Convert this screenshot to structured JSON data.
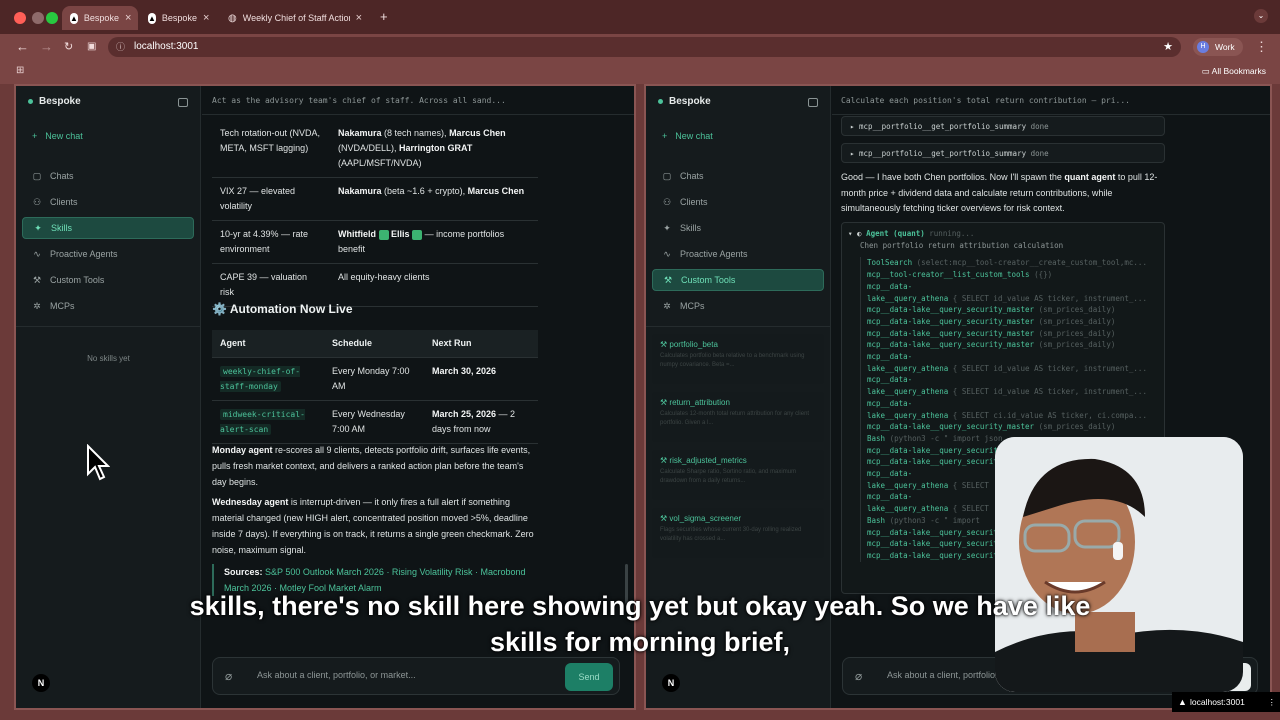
{
  "browser": {
    "tabs": [
      {
        "label": "Bespoke",
        "active": true
      },
      {
        "label": "Bespoke",
        "active": false
      },
      {
        "label": "Weekly Chief of Staff Action",
        "active": false
      }
    ],
    "url": "localhost:3001",
    "profile": "Work",
    "profile_initial": "H",
    "bookmarks_label": "All Bookmarks"
  },
  "left": {
    "app_name": "Bespoke",
    "new_chat": "New chat",
    "nav": [
      "Chats",
      "Clients",
      "Skills",
      "Proactive Agents",
      "Custom Tools",
      "MCPs"
    ],
    "active_nav": "Skills",
    "empty_state": "No skills yet",
    "prompt": "Act as the advisory team's chief of staff. Across all sand...",
    "risk_rows": [
      {
        "c1": "Tech rotation-out (NVDA, META, MSFT lagging)",
        "c2a": "Nakamura",
        "c2b": " (8 tech names), ",
        "c2c": "Marcus Chen",
        "c2d": " (NVDA/DELL), ",
        "c2e": "Harrington GRAT",
        "c2f": " (AAPL/MSFT/NVDA)"
      },
      {
        "c1": "VIX 27 — elevated volatility",
        "c2a": "Nakamura",
        "c2b": " (beta ~1.6 + crypto), ",
        "c2c": "Marcus Chen",
        "c2d": "",
        "c2e": "",
        "c2f": ""
      },
      {
        "c1": "10-yr at 4.39% — rate environment",
        "c2a": "Whitfield",
        "c2b": " ",
        "c2c": "Ellis",
        "c2d": " — income portfolios benefit",
        "c2e": "",
        "c2f": ""
      },
      {
        "c1": "CAPE 39 — valuation risk",
        "c2a": "",
        "c2b": "All equity-heavy clients",
        "c2c": "",
        "c2d": "",
        "c2e": "",
        "c2f": ""
      }
    ],
    "section_title": "⚙️ Automation Now Live",
    "sched_headers": [
      "Agent",
      "Schedule",
      "Next Run"
    ],
    "sched_rows": [
      {
        "agent": "weekly-chief-of-staff-monday",
        "schedule": "Every Monday 7:00 AM",
        "next": "March 30, 2026",
        "next_extra": ""
      },
      {
        "agent": "midweek-critical-alert-scan",
        "schedule": "Every Wednesday 7:00 AM",
        "next": "March 25, 2026",
        "next_extra": " — 2 days from now"
      }
    ],
    "monday_bold": "Monday agent",
    "monday_text": " re-scores all 9 clients, detects portfolio drift, surfaces life events, pulls fresh market context, and delivers a ranked action plan before the team's day begins.",
    "wed_bold": "Wednesday agent",
    "wed_text": " is interrupt-driven — it only fires a full alert if something material changed (new HIGH alert, concentrated position moved >5%, deadline inside 7 days). If everything is on track, it returns a single green checkmark. Zero noise, maximum signal.",
    "sources_label": "Sources:",
    "sources": "S&P 500 Outlook March 2026 · Rising Volatility Risk · Macrobond March 2026 · Motley Fool Market Alarm",
    "input_placeholder": "Ask about a client, portfolio, or market...",
    "send": "Send"
  },
  "right": {
    "app_name": "Bespoke",
    "new_chat": "New chat",
    "nav": [
      "Chats",
      "Clients",
      "Skills",
      "Proactive Agents",
      "Custom Tools",
      "MCPs"
    ],
    "active_nav": "Custom Tools",
    "custom_tools": [
      {
        "name": "portfolio_beta",
        "desc": "Calculates portfolio beta relative to a benchmark using numpy covariance. Beta =..."
      },
      {
        "name": "return_attribution",
        "desc": "Calculates 12-month total return attribution for any client portfolio. Given a l..."
      },
      {
        "name": "risk_adjusted_metrics",
        "desc": "Calculate Sharpe ratio, Sortino ratio, and maximum drawdown from a daily returns..."
      },
      {
        "name": "vol_sigma_screener",
        "desc": "Flags securities whose current 30-day rolling realized volatility has crossed a..."
      }
    ],
    "prompt": "Calculate each position's total return contribution — pri...",
    "tool_calls": [
      {
        "name": "mcp__portfolio__get_portfolio_summary",
        "status": "done"
      },
      {
        "name": "mcp__portfolio__get_portfolio_summary",
        "status": "done"
      }
    ],
    "msg_pre": "Good — I have both Chen portfolios. Now I'll spawn the ",
    "msg_bold": "quant agent",
    "msg_post": " to pull 12-month price + dividend data and calculate return contributions, while simultaneously fetching ticker overviews for risk context.",
    "agent_title": "Agent (quant)",
    "agent_status": "running...",
    "agent_desc": "Chen portfolio return attribution calculation",
    "agent_rows": [
      {
        "t": "ToolSearch",
        "a": "(select:mcp__tool-creator__create_custom_tool,mc..."
      },
      {
        "t": "mcp__tool-creator__list_custom_tools",
        "a": "({})"
      },
      {
        "t": "mcp__data-",
        "a": ""
      },
      {
        "t": "lake__query_athena",
        "a": "{ SELECT id_value AS ticker, instrument_..."
      },
      {
        "t": "mcp__data-lake__query_security_master",
        "a": "(sm_prices_daily)"
      },
      {
        "t": "mcp__data-lake__query_security_master",
        "a": "(sm_prices_daily)"
      },
      {
        "t": "mcp__data-lake__query_security_master",
        "a": "(sm_prices_daily)"
      },
      {
        "t": "mcp__data-lake__query_security_master",
        "a": "(sm_prices_daily)"
      },
      {
        "t": "mcp__data-",
        "a": ""
      },
      {
        "t": "lake__query_athena",
        "a": "{ SELECT id_value AS ticker, instrument_..."
      },
      {
        "t": "mcp__data-",
        "a": ""
      },
      {
        "t": "lake__query_athena",
        "a": "{ SELECT id_value AS ticker, instrument_..."
      },
      {
        "t": "mcp__data-",
        "a": ""
      },
      {
        "t": "lake__query_athena",
        "a": "{ SELECT ci.id_value AS ticker, ci.compa..."
      },
      {
        "t": "mcp__data-lake__query_security_master",
        "a": "(sm_prices_daily)"
      },
      {
        "t": "Bash",
        "a": "(python3 -c \" import json..."
      },
      {
        "t": "mcp__data-lake__query_security_master",
        "a": ""
      },
      {
        "t": "mcp__data-lake__query_security_master",
        "a": ""
      },
      {
        "t": "mcp__data-",
        "a": ""
      },
      {
        "t": "lake__query_athena",
        "a": "{ SELECT"
      },
      {
        "t": "mcp__data-",
        "a": ""
      },
      {
        "t": "lake__query_athena",
        "a": "{ SELECT"
      },
      {
        "t": "Bash",
        "a": "(python3 -c \" import"
      },
      {
        "t": "mcp__data-lake__query_security_master",
        "a": ""
      },
      {
        "t": "mcp__data-lake__query_security_master",
        "a": ""
      },
      {
        "t": "mcp__data-lake__query_security_master",
        "a": ""
      }
    ],
    "input_placeholder": "Ask about a client, portfolio, or m...",
    "stop": "Stop"
  },
  "subtitle_line1": "skills, there's no skill here showing yet but okay yeah. So we have like",
  "subtitle_line2": "skills for morning brief,",
  "status_url": "localhost:3001",
  "n_badge": "N"
}
